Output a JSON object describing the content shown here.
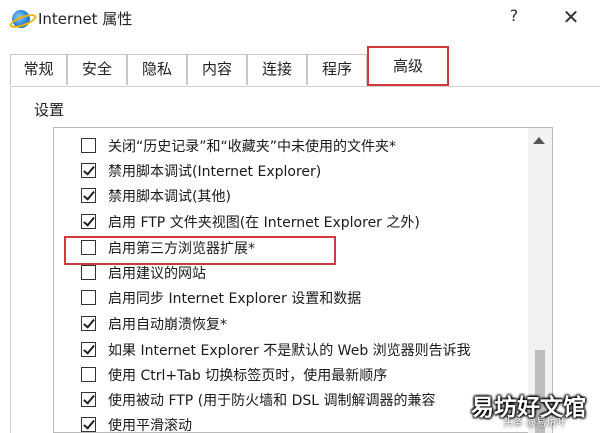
{
  "window": {
    "title": "Internet 属性",
    "help_label": "?",
    "close_label": "✕",
    "icon": "internet-explorer-icon"
  },
  "tabs": [
    {
      "label": "常规"
    },
    {
      "label": "安全"
    },
    {
      "label": "隐私"
    },
    {
      "label": "内容"
    },
    {
      "label": "连接"
    },
    {
      "label": "程序"
    },
    {
      "label": "高级",
      "active": true
    }
  ],
  "settings": {
    "label": "设置",
    "items": [
      {
        "label": "关闭“历史记录”和“收藏夹”中未使用的文件夹*",
        "checked": false
      },
      {
        "label": "禁用脚本调试(Internet Explorer)",
        "checked": true
      },
      {
        "label": "禁用脚本调试(其他)",
        "checked": true
      },
      {
        "label": "启用 FTP 文件夹视图(在 Internet Explorer 之外)",
        "checked": true
      },
      {
        "label": "启用第三方浏览器扩展*",
        "checked": false
      },
      {
        "label": "启用建议的网站",
        "checked": false
      },
      {
        "label": "启用同步 Internet Explorer 设置和数据",
        "checked": false
      },
      {
        "label": "启用自动崩溃恢复*",
        "checked": true
      },
      {
        "label": "如果 Internet Explorer 不是默认的 Web 浏览器则告诉我",
        "checked": true
      },
      {
        "label": "使用 Ctrl+Tab 切换标签页时，使用最新顺序",
        "checked": false
      },
      {
        "label": "使用被动 FTP (用于防火墙和 DSL 调制解调器的兼容",
        "checked": true
      },
      {
        "label": "使用平滑滚动",
        "checked": true
      }
    ]
  },
  "colors": {
    "highlight": "#d2393b",
    "accent": "#d2393b"
  },
  "watermark": {
    "text": "易坊好文馆",
    "sub": "头条 @易坊叶"
  }
}
